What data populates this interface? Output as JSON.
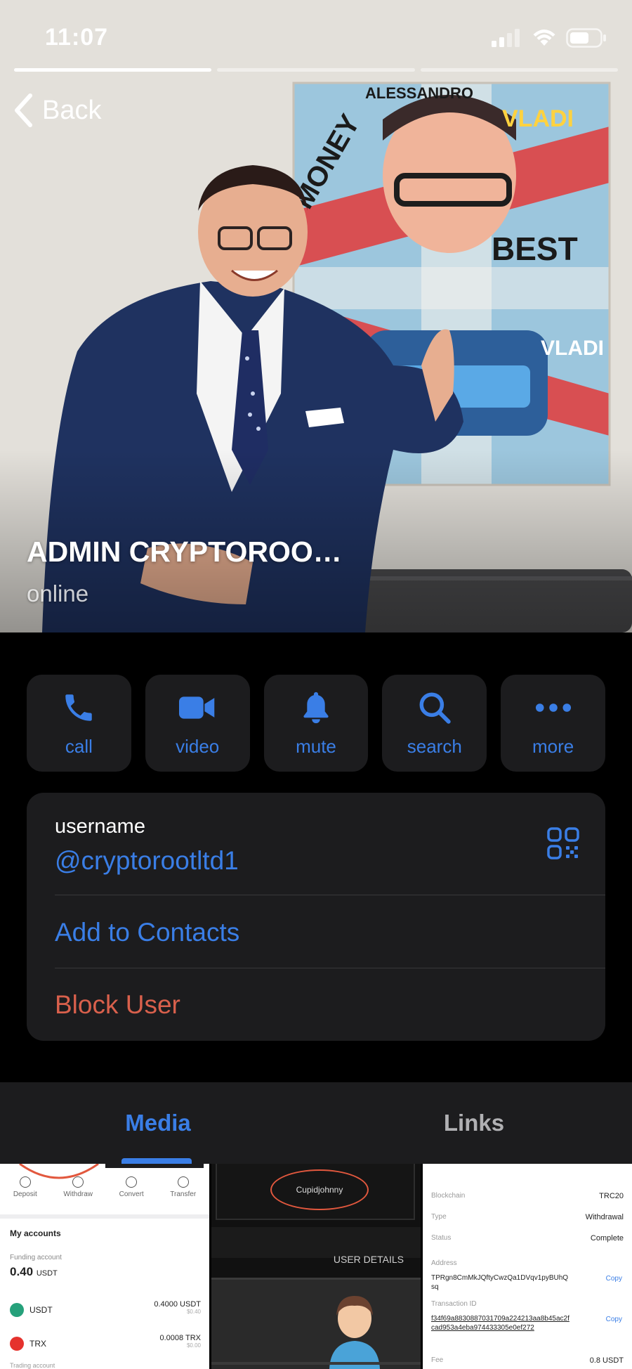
{
  "status_bar": {
    "time": "11:07"
  },
  "nav": {
    "back_label": "Back"
  },
  "profile": {
    "name": "ADMIN CRYPTOROO…",
    "status": "online"
  },
  "actions": [
    {
      "label": "call",
      "icon": "phone-icon"
    },
    {
      "label": "video",
      "icon": "video-camera-icon"
    },
    {
      "label": "mute",
      "icon": "bell-icon"
    },
    {
      "label": "search",
      "icon": "search-icon"
    },
    {
      "label": "more",
      "icon": "more-dots-icon"
    }
  ],
  "info": {
    "username_caption": "username",
    "username": "@cryptorootltd1",
    "add_contact": "Add to Contacts",
    "block_user": "Block User"
  },
  "tabs": [
    {
      "label": "Media",
      "active": true
    },
    {
      "label": "Links",
      "active": false
    }
  ],
  "media": {
    "wallet": {
      "actions": [
        "Deposit",
        "Withdraw",
        "Convert",
        "Transfer"
      ],
      "title": "My accounts",
      "funding_label": "Funding account",
      "funding_value": "0.40",
      "funding_unit": "USDT",
      "coins": [
        {
          "name": "USDT",
          "amount": "0.4000 USDT",
          "fiat": "$0.40",
          "color": "#26a17b"
        },
        {
          "name": "TRX",
          "amount": "0.0008 TRX",
          "fiat": "$0.00",
          "color": "#e5322d"
        }
      ],
      "footer": "Trading account"
    },
    "user_details": {
      "name": "Cupidjohnny",
      "heading": "USER DETAILS"
    },
    "transaction": {
      "rows": [
        {
          "label": "Blockchain",
          "value": "TRC20"
        },
        {
          "label": "Type",
          "value": "Withdrawal"
        },
        {
          "label": "Status",
          "value": "Complete"
        }
      ],
      "address_label": "Address",
      "address": "TPRgn8CmMkJQftyCwzQa1DVqv1pyBUhQsq",
      "txid_label": "Transaction ID",
      "txid": "f34f69a8830887031709a224213aa8b45ac2fcad953a4eba974433305e0ef272",
      "copy_label": "Copy",
      "fee_label": "Fee",
      "fee_value": "0.8 USDT"
    }
  },
  "colors": {
    "accent": "#3a7ee6",
    "destructive": "#d9604c",
    "card": "#1c1c1e"
  }
}
